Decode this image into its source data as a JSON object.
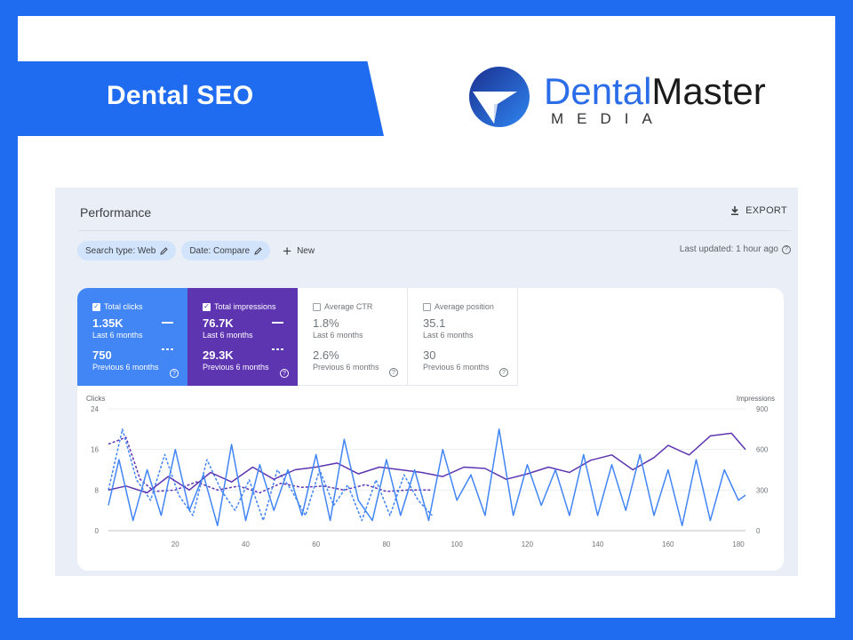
{
  "banner": {
    "title": "Dental SEO"
  },
  "logo": {
    "word1": "Dental",
    "word2": "Master",
    "sub": "MEDIA"
  },
  "colors": {
    "brand_blue": "#1f6cf0",
    "clicks": "#4285f4",
    "impressions": "#5e35b1"
  },
  "gsc": {
    "title": "Performance",
    "export_label": "EXPORT",
    "chips": [
      "Search type: Web",
      "Date: Compare"
    ],
    "new_label": "New",
    "last_updated": "Last updated: 1 hour ago",
    "metrics": [
      {
        "label": "Total clicks",
        "checked": true,
        "value": "1.35K",
        "period": "Last 6 months",
        "prev_value": "750",
        "prev_period": "Previous 6 months"
      },
      {
        "label": "Total impressions",
        "checked": true,
        "value": "76.7K",
        "period": "Last 6 months",
        "prev_value": "29.3K",
        "prev_period": "Previous 6 months"
      },
      {
        "label": "Average CTR",
        "checked": false,
        "value": "1.8%",
        "period": "Last 6 months",
        "prev_value": "2.6%",
        "prev_period": "Previous 6 months"
      },
      {
        "label": "Average position",
        "checked": false,
        "value": "35.1",
        "period": "Last 6 months",
        "prev_value": "30",
        "prev_period": "Previous 6 months"
      }
    ]
  },
  "chart_data": {
    "type": "line",
    "left_axis_label": "Clicks",
    "right_axis_label": "Impressions",
    "left_ylim": [
      0,
      24
    ],
    "right_ylim": [
      0,
      900
    ],
    "left_ticks": [
      "0",
      "8",
      "16",
      "24"
    ],
    "right_ticks": [
      "0",
      "300",
      "600",
      "900"
    ],
    "x_ticks": [
      "20",
      "40",
      "60",
      "80",
      "100",
      "120",
      "140",
      "160",
      "180"
    ],
    "xlim": [
      1,
      182
    ],
    "series": [
      {
        "key": "clicks_current",
        "style": "solid",
        "color": "#4285f4",
        "axis": "left",
        "x": [
          1,
          4,
          8,
          12,
          16,
          20,
          24,
          28,
          32,
          36,
          40,
          44,
          48,
          52,
          56,
          60,
          64,
          68,
          72,
          76,
          80,
          84,
          88,
          92,
          96,
          100,
          104,
          108,
          112,
          116,
          120,
          124,
          128,
          132,
          136,
          140,
          144,
          148,
          152,
          156,
          160,
          164,
          168,
          172,
          176,
          180,
          182
        ],
        "y": [
          5,
          14,
          2,
          12,
          3,
          16,
          4,
          11,
          1,
          17,
          2,
          13,
          4,
          12,
          3,
          15,
          2,
          18,
          6,
          2,
          14,
          3,
          12,
          2,
          16,
          6,
          11,
          3,
          20,
          3,
          13,
          5,
          12,
          3,
          15,
          3,
          13,
          4,
          15,
          3,
          12,
          1,
          14,
          2,
          12,
          6,
          7
        ]
      },
      {
        "key": "impressions_current",
        "style": "solid",
        "color": "#5e35b1",
        "axis": "right",
        "x": [
          1,
          6,
          12,
          18,
          24,
          30,
          36,
          42,
          48,
          54,
          60,
          66,
          72,
          78,
          84,
          90,
          96,
          102,
          108,
          114,
          120,
          126,
          132,
          138,
          144,
          150,
          156,
          160,
          166,
          172,
          178,
          182
        ],
        "y": [
          300,
          330,
          280,
          400,
          300,
          430,
          360,
          470,
          380,
          450,
          470,
          500,
          420,
          470,
          450,
          430,
          400,
          470,
          460,
          380,
          420,
          470,
          430,
          520,
          560,
          450,
          540,
          630,
          560,
          700,
          720,
          600
        ]
      },
      {
        "key": "clicks_previous",
        "style": "dashed",
        "color": "#4285f4",
        "axis": "left",
        "x": [
          1,
          5,
          9,
          13,
          17,
          21,
          25,
          29,
          33,
          37,
          41,
          45,
          49,
          53,
          57,
          61,
          65,
          69,
          73,
          77,
          81,
          85,
          89,
          93
        ],
        "y": [
          8,
          20,
          10,
          6,
          15,
          7,
          3,
          14,
          8,
          4,
          10,
          2,
          12,
          8,
          3,
          12,
          5,
          9,
          2,
          10,
          3,
          11,
          6,
          3
        ]
      },
      {
        "key": "impressions_previous",
        "style": "dashed",
        "color": "#5e35b1",
        "axis": "right",
        "x": [
          1,
          6,
          10,
          14,
          20,
          26,
          32,
          38,
          44,
          50,
          56,
          62,
          68,
          74,
          80,
          86,
          93
        ],
        "y": [
          640,
          690,
          380,
          290,
          300,
          360,
          300,
          330,
          280,
          350,
          320,
          330,
          300,
          340,
          290,
          300,
          300
        ]
      }
    ]
  }
}
